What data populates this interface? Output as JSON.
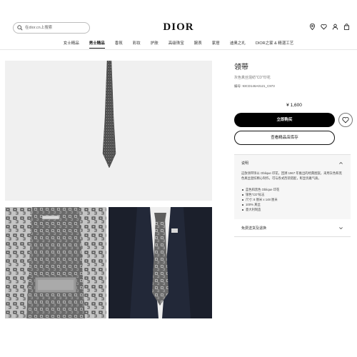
{
  "header": {
    "search_placeholder": "在dior.cn上搜索",
    "logo": "DIOR",
    "icons": [
      "location-icon",
      "heart-icon",
      "user-icon",
      "bag-icon"
    ]
  },
  "nav": {
    "items": [
      {
        "label": "女士精品",
        "active": false
      },
      {
        "label": "男士精品",
        "active": true
      },
      {
        "label": "香氛",
        "active": false
      },
      {
        "label": "彩妆",
        "active": false
      },
      {
        "label": "护肤",
        "active": false
      },
      {
        "label": "高级珠宝",
        "active": false
      },
      {
        "label": "腕表",
        "active": false
      },
      {
        "label": "家居",
        "active": false
      },
      {
        "label": "迪奥之礼",
        "active": false
      },
      {
        "label": "DIOR之家 & 精湛工艺",
        "active": false
      }
    ]
  },
  "product": {
    "title": "领带",
    "subtitle": "灰色真丝混纺\"CD\"印花",
    "code": "编号: 93CD146A0121_C973",
    "price": "¥ 1,600",
    "buy_label": "立即购买",
    "store_label": "查看精品店库存",
    "description": {
      "heading": "说明",
      "text": "这款领带饰以 Oblique 印花，回溯 1967 年推出的经典图案，采用灰色和黑色真丝混纺精心制作，可与各式西装搭配，彰显优雅气质。",
      "bullets": [
        "蓝色和黑色 Oblique 印花",
        "银色\"CD\"标志",
        "尺寸: 8 厘米 x 148 厘米",
        "100% 真丝",
        "意大利制造"
      ]
    },
    "shipping_label": "免费送货及退换"
  },
  "colors": {
    "accent": "#000000",
    "panel_bg": "#f6f6f6",
    "image_bg": "#f0f0f0",
    "suit": "#1b1f2b"
  }
}
